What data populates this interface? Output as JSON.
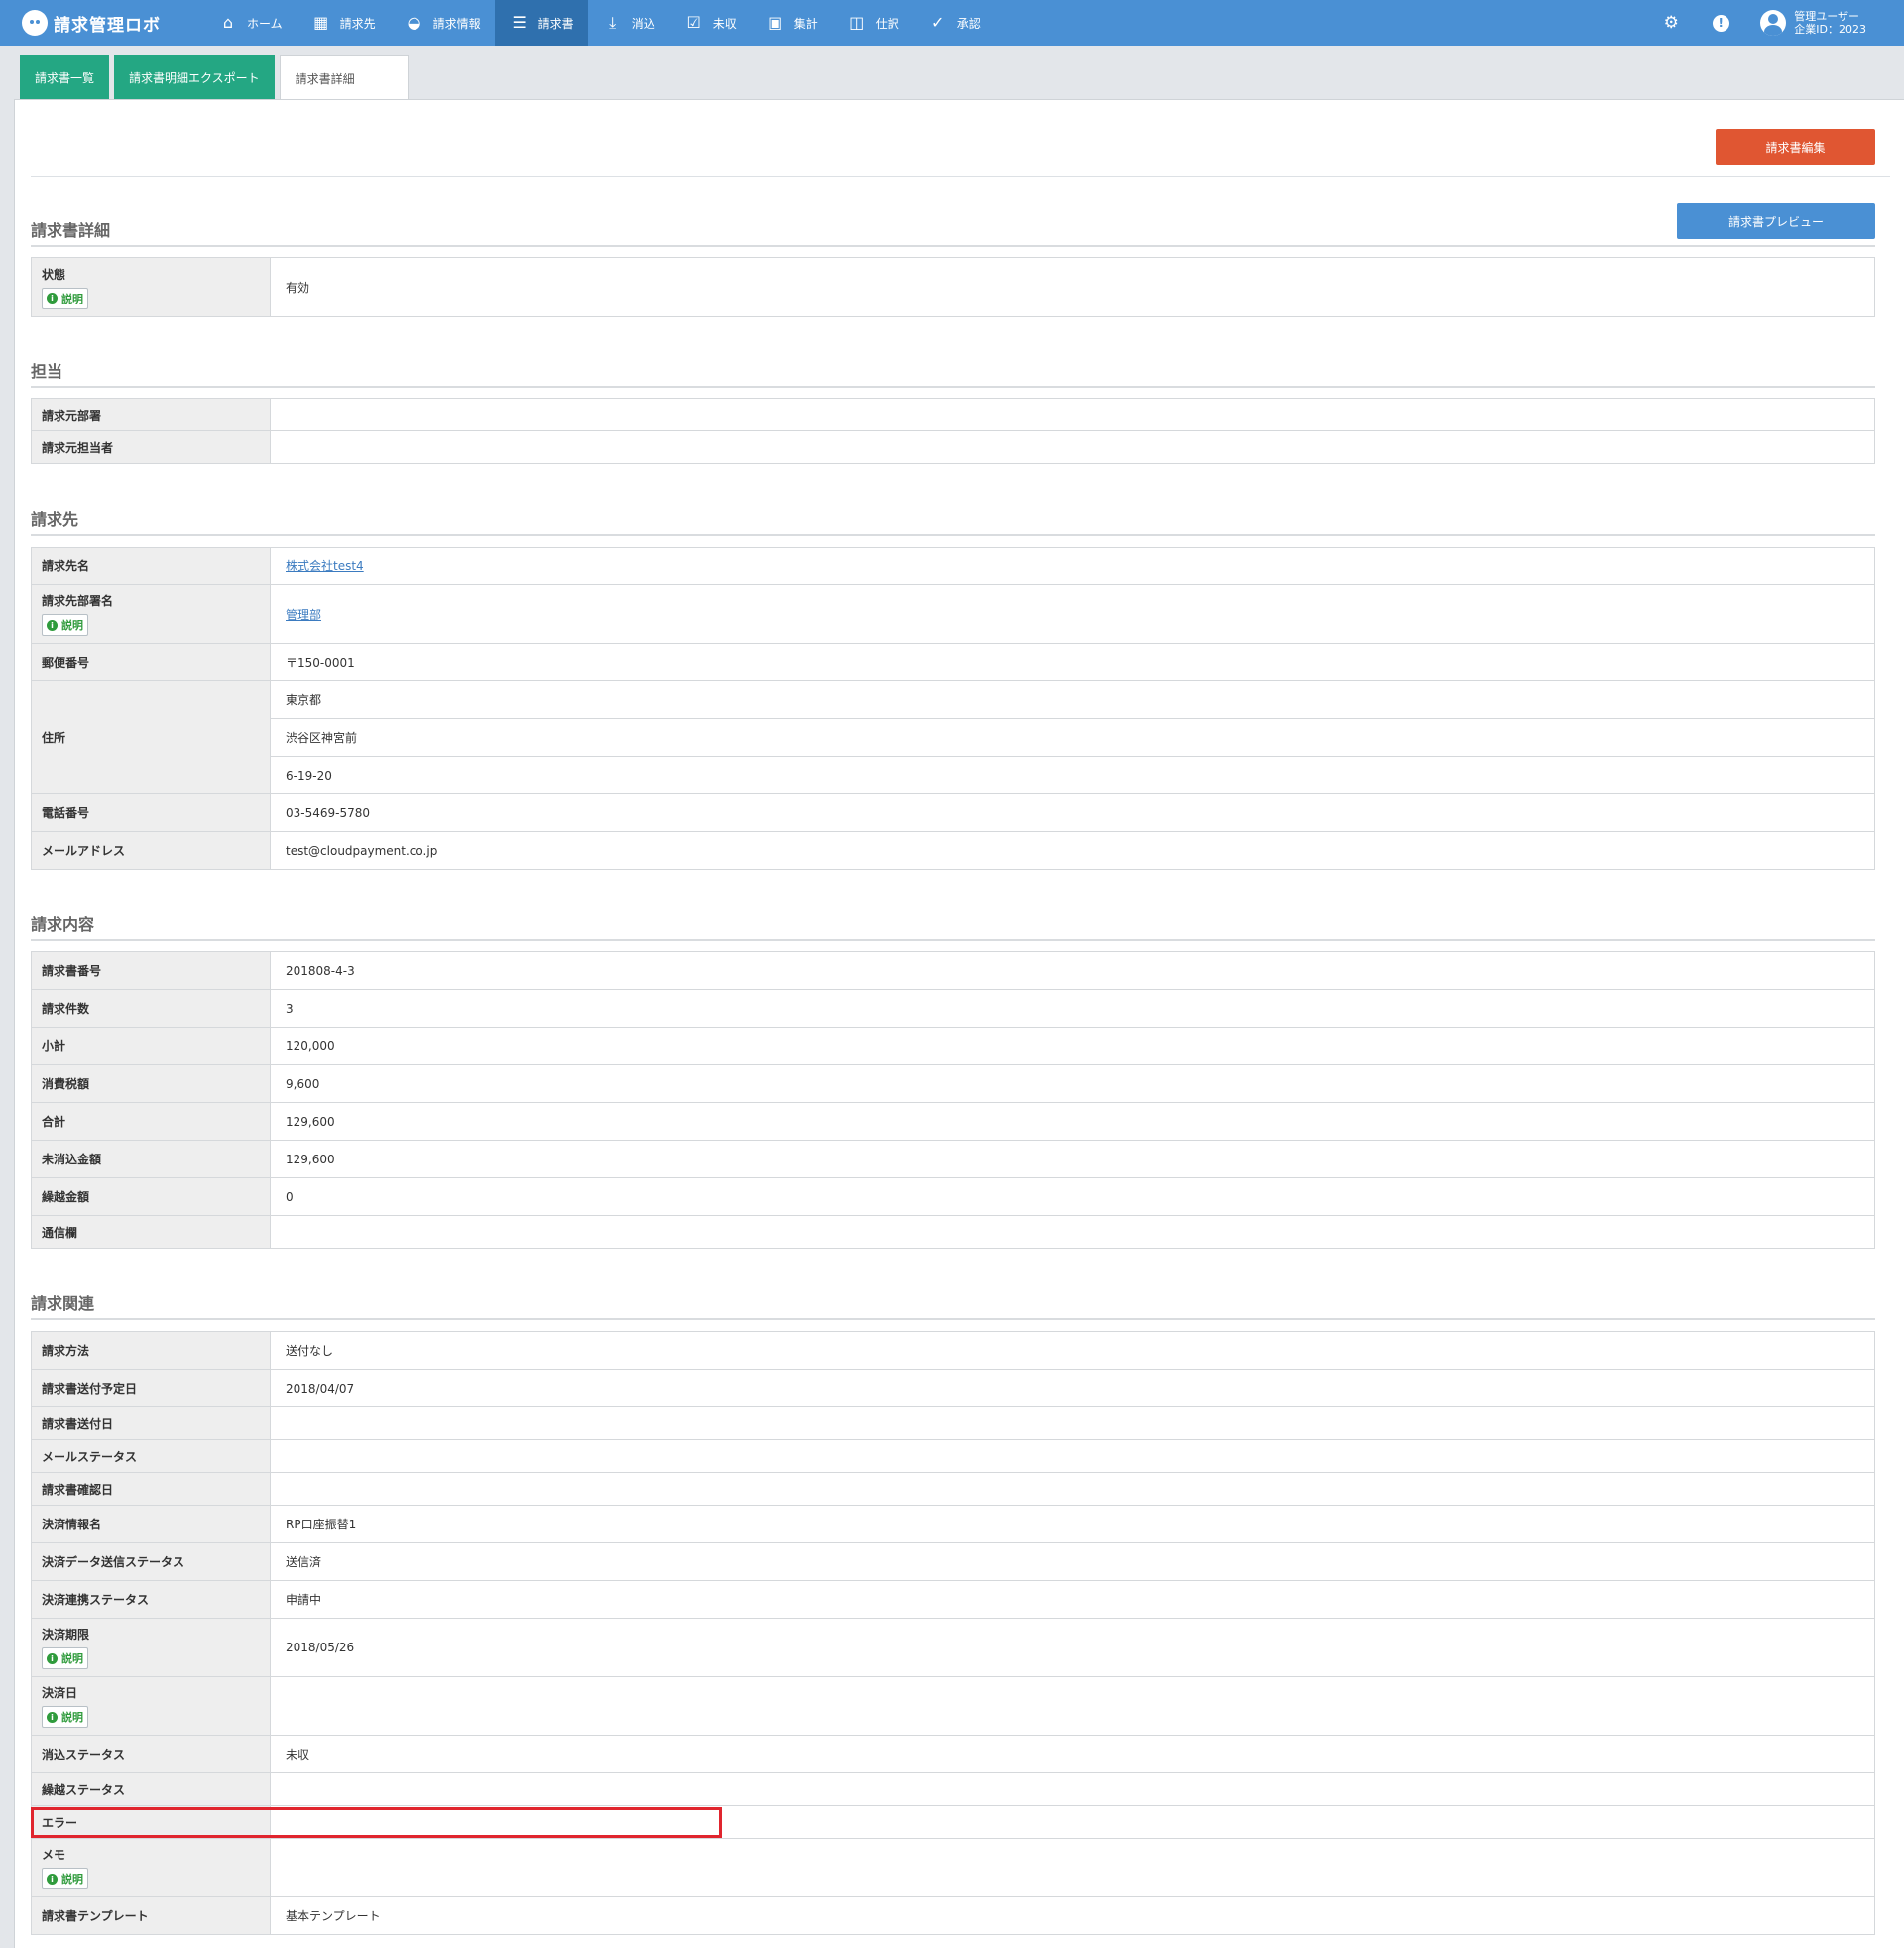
{
  "app": {
    "logo_text": "請求管理ロボ"
  },
  "nav": [
    {
      "label": "ホーム",
      "icon": "home-icon",
      "glyph": "⌂"
    },
    {
      "label": "請求先",
      "icon": "building-icon",
      "glyph": "▦"
    },
    {
      "label": "請求情報",
      "icon": "inbox-icon",
      "glyph": "◒"
    },
    {
      "label": "請求書",
      "icon": "list-icon",
      "glyph": "☰"
    },
    {
      "label": "消込",
      "icon": "download-icon",
      "glyph": "⤓"
    },
    {
      "label": "未収",
      "icon": "checkbox-icon",
      "glyph": "☑"
    },
    {
      "label": "集計",
      "icon": "calculator-icon",
      "glyph": "▣"
    },
    {
      "label": "仕訳",
      "icon": "columns-icon",
      "glyph": "◫"
    },
    {
      "label": "承認",
      "icon": "check-circle-icon",
      "glyph": "✓"
    }
  ],
  "user": {
    "name": "管理ユーザー",
    "company_id": "企業ID：2023"
  },
  "tabs": [
    "請求書一覧",
    "請求書明細エクスポート",
    "請求書詳細"
  ],
  "buttons": {
    "edit": "請求書編集",
    "preview": "請求書プレビュー"
  },
  "help_label": "説明",
  "sections": {
    "detail": {
      "title": "請求書詳細",
      "rows": [
        {
          "label": "状態",
          "value": "有効"
        }
      ]
    },
    "tanto": {
      "title": "担当",
      "rows": [
        {
          "label": "請求元部署",
          "value": ""
        },
        {
          "label": "請求元担当者",
          "value": ""
        }
      ]
    },
    "billing_to": {
      "title": "請求先",
      "rows": [
        {
          "label": "請求先名",
          "value": "株式会社test4"
        },
        {
          "label": "請求先部署名",
          "value": "管理部"
        },
        {
          "label": "郵便番号",
          "value": "〒150-0001"
        },
        {
          "label": "住所",
          "values": [
            "東京都",
            "渋谷区神宮前",
            "6-19-20"
          ]
        },
        {
          "label": "電話番号",
          "value": "03-5469-5780"
        },
        {
          "label": "メールアドレス",
          "value": "test@cloudpayment.co.jp"
        }
      ]
    },
    "content": {
      "title": "請求内容",
      "rows": [
        {
          "label": "請求書番号",
          "value": "201808-4-3"
        },
        {
          "label": "請求件数",
          "value": "3"
        },
        {
          "label": "小計",
          "value": "120,000"
        },
        {
          "label": "消費税額",
          "value": "9,600"
        },
        {
          "label": "合計",
          "value": "129,600"
        },
        {
          "label": "未消込金額",
          "value": "129,600"
        },
        {
          "label": "繰越金額",
          "value": "0"
        },
        {
          "label": "通信欄",
          "value": ""
        }
      ]
    },
    "related": {
      "title": "請求関連",
      "rows": [
        {
          "label": "請求方法",
          "value": "送付なし"
        },
        {
          "label": "請求書送付予定日",
          "value": "2018/04/07"
        },
        {
          "label": "請求書送付日",
          "value": ""
        },
        {
          "label": "メールステータス",
          "value": ""
        },
        {
          "label": "請求書確認日",
          "value": ""
        },
        {
          "label": "決済情報名",
          "value": "RP口座振替1"
        },
        {
          "label": "決済データ送信ステータス",
          "value": "送信済"
        },
        {
          "label": "決済連携ステータス",
          "value": "申請中"
        },
        {
          "label": "決済期限",
          "value": "2018/05/26"
        },
        {
          "label": "決済日",
          "value": ""
        },
        {
          "label": "消込ステータス",
          "value": "未収"
        },
        {
          "label": "繰越ステータス",
          "value": ""
        },
        {
          "label": "エラー",
          "value": ""
        },
        {
          "label": "メモ",
          "value": ""
        },
        {
          "label": "請求書テンプレート",
          "value": "基本テンプレート"
        }
      ]
    }
  }
}
